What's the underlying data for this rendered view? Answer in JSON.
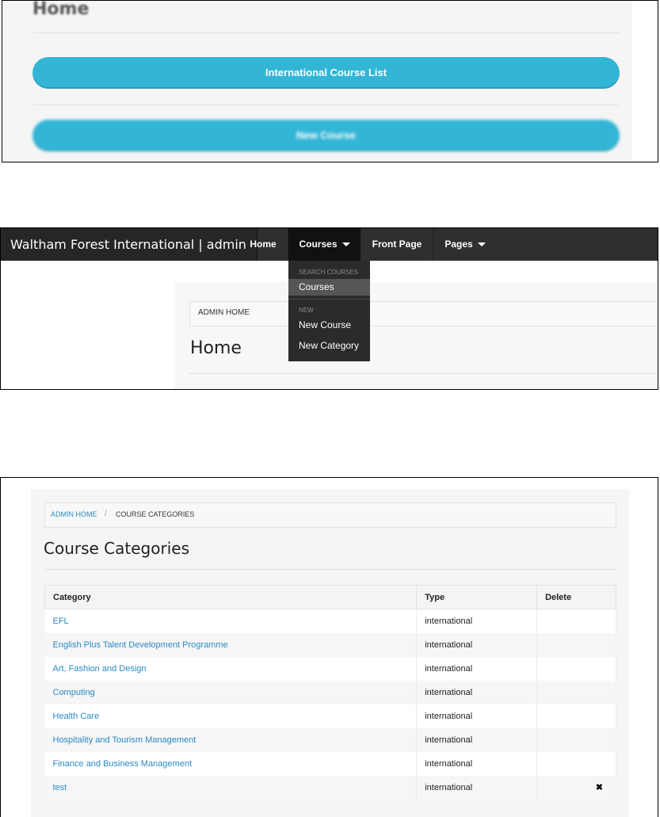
{
  "panel1": {
    "title": "Home",
    "buttons": [
      "International Course List",
      "New Course"
    ],
    "button_color": "#33b5d6"
  },
  "panel2": {
    "navbar": {
      "brand": "Waltham Forest International | admin",
      "items": [
        "Home",
        "Courses",
        "Front Page",
        "Pages"
      ]
    },
    "dropdown": {
      "header_search": "SEARCH COURSES",
      "courses": "Courses",
      "header_new": "NEW",
      "new_course": "New Course",
      "new_category": "New Category"
    },
    "breadcrumb": "ADMIN HOME",
    "title": "Home"
  },
  "panel3": {
    "breadcrumb": {
      "link": "ADMIN HOME",
      "separator": "/",
      "current": "COURSE CATEGORIES"
    },
    "title": "Course Categories",
    "table": {
      "headers": [
        "Category",
        "Type",
        "Delete"
      ],
      "rows": [
        {
          "category": "EFL",
          "type": "international",
          "delete": ""
        },
        {
          "category": "English Plus Talent Development Programme",
          "type": "international",
          "delete": ""
        },
        {
          "category": "Art, Fashion and Design",
          "type": "international",
          "delete": ""
        },
        {
          "category": "Computing",
          "type": "international",
          "delete": ""
        },
        {
          "category": "Health Care",
          "type": "international",
          "delete": ""
        },
        {
          "category": "Hospitality and Tourism Management",
          "type": "international",
          "delete": ""
        },
        {
          "category": "Finance and Business Management",
          "type": "international",
          "delete": ""
        },
        {
          "category": "test",
          "type": "international",
          "delete": "✖"
        }
      ]
    },
    "link_color": "#2a8bc3"
  }
}
